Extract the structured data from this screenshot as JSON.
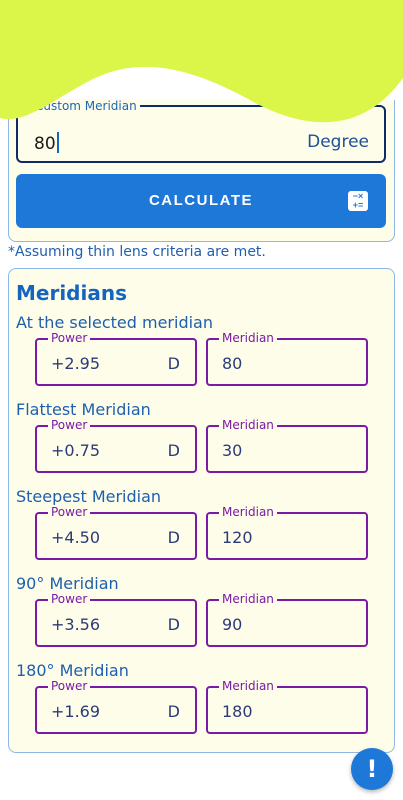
{
  "colors": {
    "accent": "#1e78d8",
    "wave": "#dcf549",
    "field_border": "#7a1aa6",
    "card_bg": "#fdfde9"
  },
  "degree_field": {
    "label": "Custom Meridian",
    "value": "80",
    "unit": "Degree"
  },
  "calculate_button": {
    "label": "CALCULATE",
    "icon": "calculator-icon"
  },
  "note": "*Assuming thin lens criteria are met.",
  "results": {
    "title": "Meridians",
    "power_label": "Power",
    "meridian_label": "Meridian",
    "unit": "D",
    "rows": [
      {
        "label": "At the selected meridian",
        "power": "+2.95",
        "meridian": "80"
      },
      {
        "label": "Flattest Meridian",
        "power": "+0.75",
        "meridian": "30"
      },
      {
        "label": "Steepest Meridian",
        "power": "+4.50",
        "meridian": "120"
      },
      {
        "label": "90° Meridian",
        "power": "+3.56",
        "meridian": "90"
      },
      {
        "label": "180° Meridian",
        "power": "+1.69",
        "meridian": "180"
      }
    ]
  },
  "fab": {
    "icon": "exclamation-icon",
    "glyph": "!"
  }
}
